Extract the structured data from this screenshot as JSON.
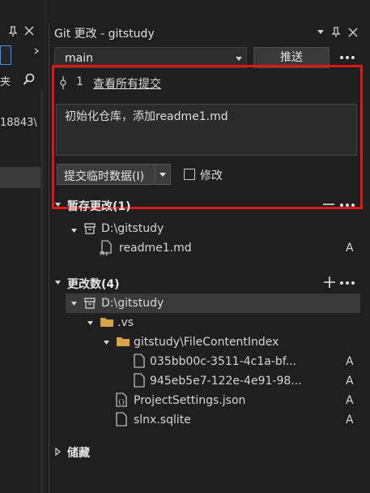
{
  "left_pane": {
    "search_label_partial": "夹 ",
    "list_item_partial": "18843\\"
  },
  "git_pane": {
    "title": "Git 更改 - gitstudy",
    "branch": "main",
    "push_label": "推送",
    "commits_ahead": "1",
    "view_all_commits": "查看所有提交",
    "commit_message": "初始化仓库，添加readme1.md",
    "commit_button": "提交临时数据(I)",
    "amend_label": "修改",
    "staged": {
      "header": "暂存更改(1)",
      "repo": "D:\\gitstudy",
      "files": [
        {
          "name": "readme1.md",
          "status": "A"
        }
      ]
    },
    "changes": {
      "header": "更改数(4)",
      "repo": "D:\\gitstudy",
      "folder_vs": ".vs",
      "folder_index": "gitstudy\\FileContentIndex",
      "files": [
        {
          "name": "035bb00c-3511-4c1a-bf...",
          "status": "A"
        },
        {
          "name": "945eb5e7-122e-4e91-98...",
          "status": "A"
        },
        {
          "name": "ProjectSettings.json",
          "status": "A"
        },
        {
          "name": "slnx.sqlite",
          "status": "A"
        }
      ]
    },
    "stashes_header": "储藏"
  },
  "colors": {
    "accent": "#3794ff",
    "highlight": "#e01717",
    "folder": "#d7a24a"
  }
}
